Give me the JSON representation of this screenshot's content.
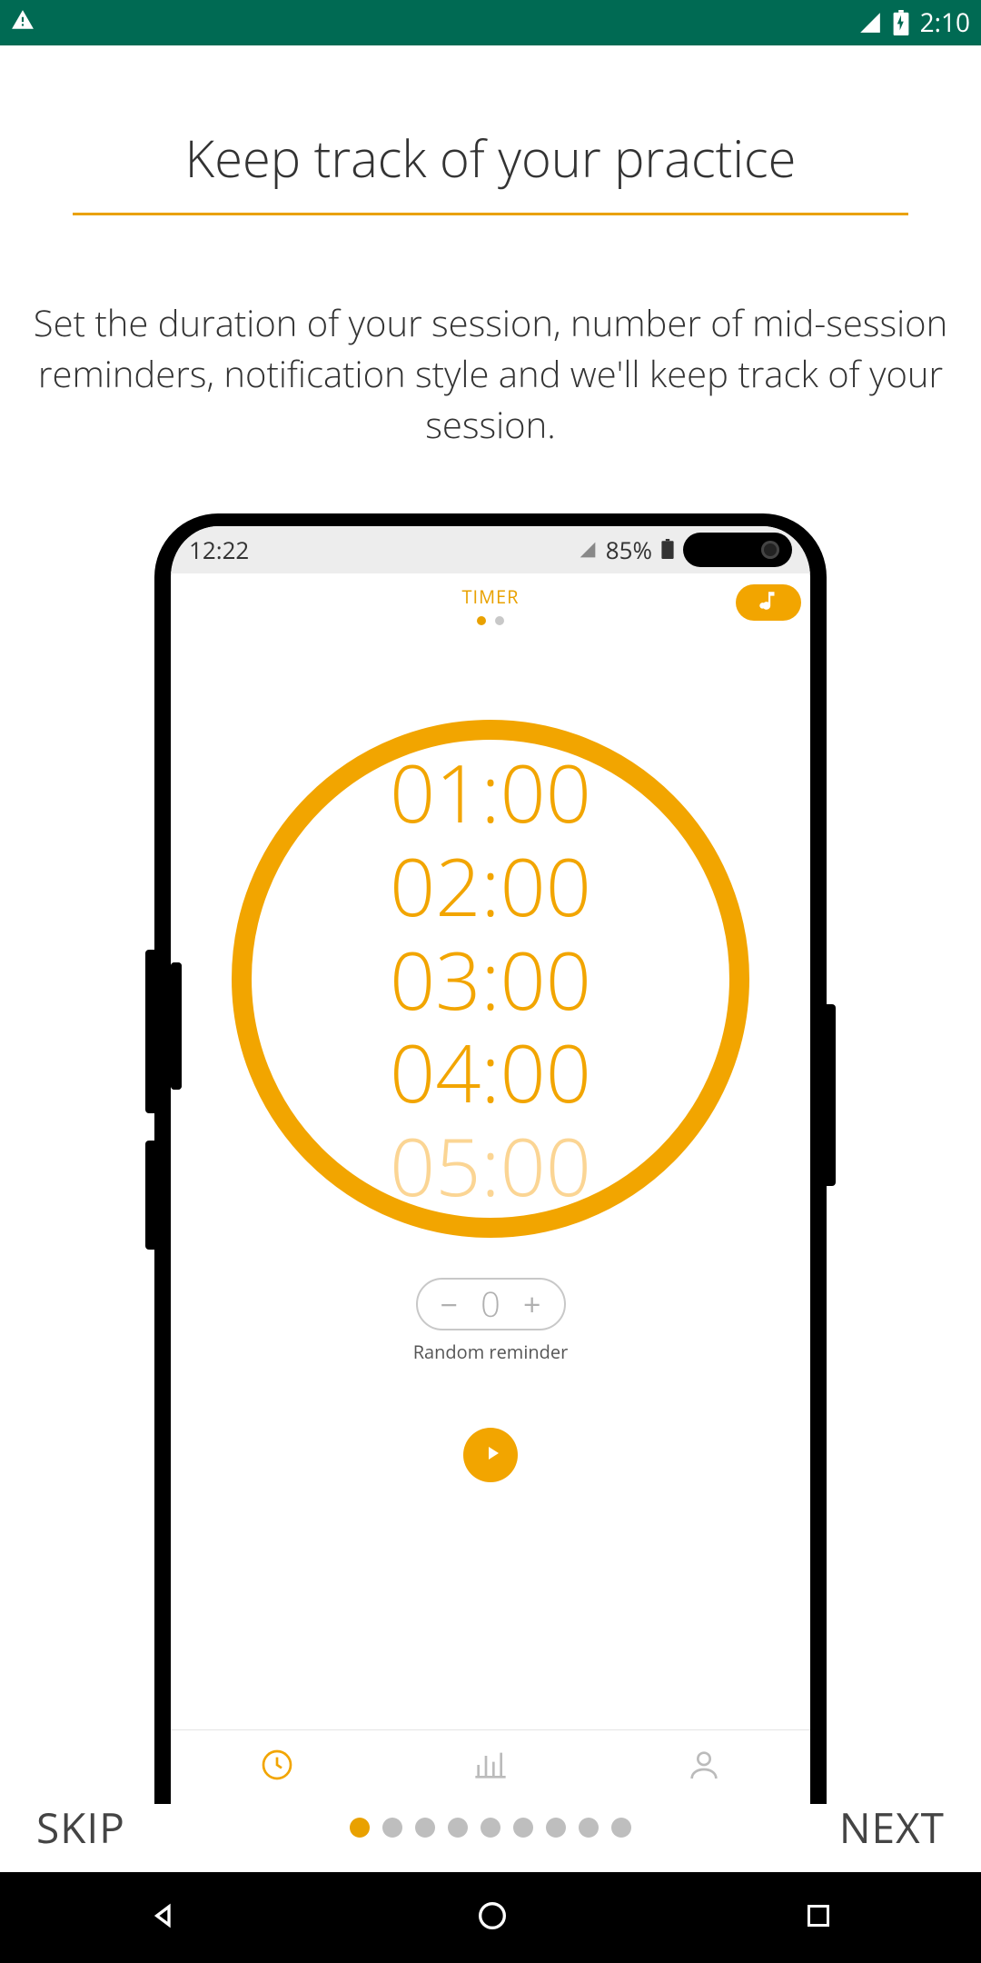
{
  "status_bar": {
    "time": "2:10"
  },
  "page": {
    "title": "Keep track of your practice",
    "subtitle": "Set the duration of your session, number of mid-session reminders, notification style and we'll keep track of your session."
  },
  "preview": {
    "inner_status": {
      "time": "12:22",
      "battery_pct": "85%"
    },
    "timer": {
      "header_label": "TIMER",
      "page_dots": {
        "count": 2,
        "active": 0
      },
      "values": [
        "01:00",
        "02:00",
        "03:00",
        "04:00",
        "05:00"
      ]
    },
    "reminder": {
      "value": "0",
      "label": "Random reminder"
    }
  },
  "controls": {
    "skip_label": "SKIP",
    "next_label": "NEXT",
    "pagination": {
      "count": 9,
      "active": 0
    }
  }
}
